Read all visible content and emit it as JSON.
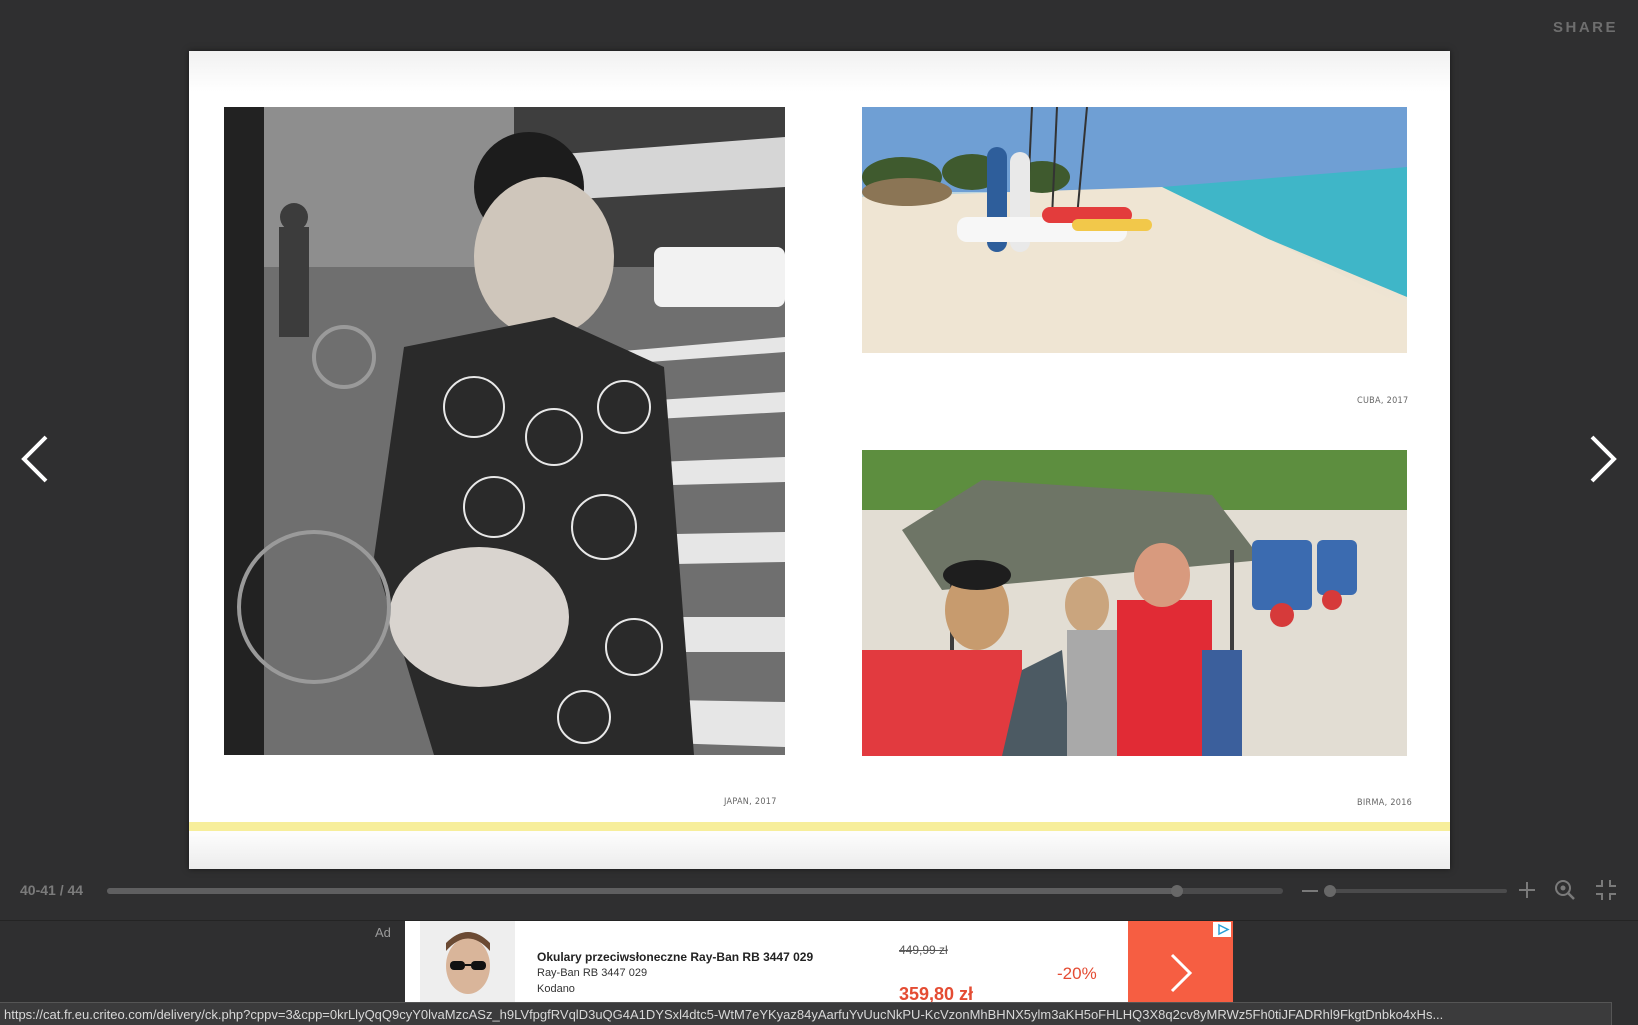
{
  "header": {
    "share_label": "SHARE"
  },
  "book": {
    "captions": {
      "japan": "JAPAN, 2017",
      "cuba": "CUBA, 2017",
      "burma": "BIRMA, 2016"
    }
  },
  "controls": {
    "page_indicator": "40-41 / 44",
    "progress": 0.91,
    "zoom": 0.03
  },
  "ad": {
    "label": "Ad",
    "title": "Okulary przeciwsłoneczne Ray-Ban RB 3447 029",
    "model": "Ray-Ban RB 3447 029",
    "store": "Kodano",
    "old_price": "449,99 zł",
    "new_price": "359,80 zł",
    "discount": "-20%"
  },
  "status": {
    "url": "https://cat.fr.eu.criteo.com/delivery/ck.php?cppv=3&cpp=0krLlyQqQ9cyY0lvaMzcASz_h9LVfpgfRVqlD3uQG4A1DYSxl4dtc5-WtM7eYKyaz84yAarfuYvUucNkPU-KcVzonMhBHNX5ylm3aKH5oFHLHQ3X8q2cv8yMRWz5Fh0tiJFADRhl9FkgtDnbko4xHs..."
  },
  "colors": {
    "background": "#2f2f30",
    "accent_yellow": "#f7ee9b",
    "ad_cta": "#f65e42",
    "ad_price": "#e44c33"
  },
  "icons": [
    "chevron-left-icon",
    "chevron-right-icon",
    "minus-icon",
    "plus-icon",
    "zoom-icon",
    "fullscreen-exit-icon",
    "chevron-right-icon",
    "adchoices-icon"
  ]
}
